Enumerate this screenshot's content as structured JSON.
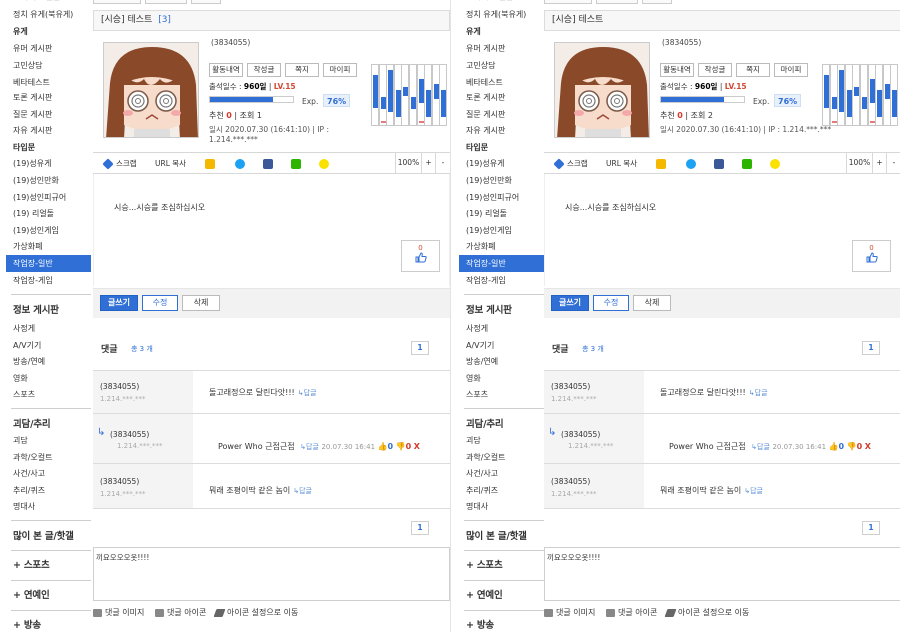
{
  "sidebar": {
    "items": [
      {
        "label": "정치 유게(북유게)",
        "style": "normal"
      },
      {
        "label": "유게",
        "style": "bold"
      },
      {
        "label": "유머 게시판",
        "style": "normal"
      },
      {
        "label": "고민상담",
        "style": "normal"
      },
      {
        "label": "베타테스트",
        "style": "normal"
      },
      {
        "label": "토론 게시판",
        "style": "normal"
      },
      {
        "label": "질문 게시판",
        "style": "normal"
      },
      {
        "label": "자유 게시판",
        "style": "normal"
      },
      {
        "label": "타입문",
        "style": "bold"
      },
      {
        "label": "(19)성유게",
        "style": "normal"
      },
      {
        "label": "(19)성인만화",
        "style": "normal"
      },
      {
        "label": "(19)성인피규어",
        "style": "normal"
      },
      {
        "label": "(19) 리얼돌",
        "style": "normal"
      },
      {
        "label": "(19)성인게임",
        "style": "normal"
      },
      {
        "label": "가상화폐",
        "style": "normal"
      },
      {
        "label": "작업장-일반",
        "style": "active"
      },
      {
        "label": "작업장-게임",
        "style": "normal"
      }
    ],
    "section2_title": "정보 게시판",
    "section2_items": [
      "사정게",
      "A/V기기",
      "방송/연예",
      "영화",
      "스포츠"
    ],
    "section3_title": "괴담/추리",
    "section3_items": [
      "괴담",
      "과학/오컬트",
      "사건/사고",
      "추리/퀴즈",
      "명대사"
    ],
    "section4_title": "많이 본 글/핫갤",
    "more_items": [
      "+ 스포츠",
      "+ 연예인",
      "+ 방송"
    ]
  },
  "post": {
    "category": "[시승]",
    "title": "테스트",
    "comment_count": "[3]",
    "user_id": "(3834055)",
    "profile_buttons": [
      "활동내역",
      "작성글",
      "쪽지",
      "마이피"
    ],
    "attend_label": "출석일수 :",
    "attend_days": "960일",
    "level": "LV.15",
    "exp_label": "Exp.",
    "exp_percent": "76%",
    "exp_fraction": 0.76,
    "recommend_label": "추천",
    "recommend_count": "0",
    "views_label": "조회",
    "date_line": "일시 2020.07.30 (16:41:10)  |  IP : 1.214.***.***",
    "body": "시승...시승를 조심하십시오",
    "like_count": "0"
  },
  "views_left": "1",
  "views_right": "2",
  "share": {
    "scrap": "스크랩",
    "url_copy": "URL 복사",
    "zoom": "100%",
    "plus": "+",
    "minus": "-"
  },
  "actions": {
    "write": "글쓰기",
    "edit": "수정",
    "delete": "삭제"
  },
  "comments": {
    "label": "댓글",
    "total": "총 3 개",
    "page": "1",
    "reply_label": "↳답글",
    "items": [
      {
        "uid": "(3834055)",
        "ip": "1.214.***.***",
        "text": "돌고래정으로 달린다앗!!!"
      },
      {
        "uid": "(3834055)",
        "ip": "1.214.***.***",
        "author": "Power Who",
        "text": "근접근접",
        "time": "20.07.30 16:41",
        "up": "0",
        "down": "0",
        "x": "X"
      },
      {
        "uid": "(3834055)",
        "ip": "1.214.***.***",
        "text": "뭐래 조평이딱 같은 놈이"
      }
    ],
    "draft_left": "끼요오오오옷!!!!",
    "draft_right": "끼요오오오옷!!!!"
  },
  "tools": {
    "image": "댓글 이미지",
    "icon": "댓글 아이콘",
    "icon_settings": "아이콘 설정으로 이동"
  },
  "colors": {
    "accent": "#2f6fd6",
    "level": "#d24a35",
    "twitter": "#1da1f2",
    "facebook": "#3b5998",
    "band": "#2db400",
    "kakao": "#fae100",
    "cyworld": "#f5b800"
  },
  "mini_bars": [
    [
      0.55,
      0.0
    ],
    [
      0.2,
      0.5
    ],
    [
      0.7,
      0.0
    ],
    [
      0.45,
      0.0
    ],
    [
      0.15,
      0.0
    ],
    [
      0.2,
      0.0
    ],
    [
      0.4,
      0.1
    ],
    [
      0.45,
      0.0
    ],
    [
      0.25,
      0.0
    ],
    [
      0.45,
      0.0
    ]
  ]
}
